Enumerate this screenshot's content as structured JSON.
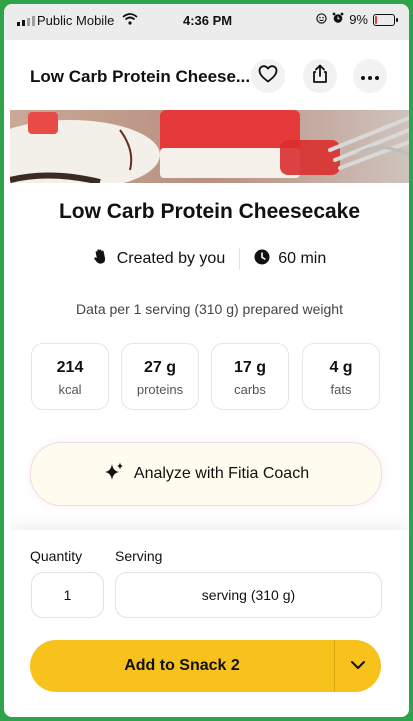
{
  "status_bar": {
    "carrier": "Public Mobile",
    "time": "4:36 PM",
    "battery_text": "9%",
    "battery_level": 0.09,
    "battery_color": "#e23b3b"
  },
  "header": {
    "title": "Low Carb Protein Cheese...",
    "icons": [
      "heart-icon",
      "share-icon",
      "more-icon"
    ]
  },
  "recipe": {
    "title": "Low Carb Protein Cheesecake",
    "creator": "Created by you",
    "time": "60 min",
    "serving_note": "Data per 1 serving (310 g) prepared weight"
  },
  "macros": [
    {
      "value": "214",
      "unit": "kcal"
    },
    {
      "value": "27 g",
      "unit": "proteins"
    },
    {
      "value": "17 g",
      "unit": "carbs"
    },
    {
      "value": "4 g",
      "unit": "fats"
    }
  ],
  "analyze": {
    "label": "Analyze with Fitia Coach"
  },
  "quantity": {
    "label": "Quantity",
    "value": "1"
  },
  "serving": {
    "label": "Serving",
    "value": "serving (310 g)"
  },
  "add_button": {
    "label": "Add to Snack 2"
  },
  "colors": {
    "accent": "#f8c21c",
    "frame_green": "#2fa34a"
  }
}
